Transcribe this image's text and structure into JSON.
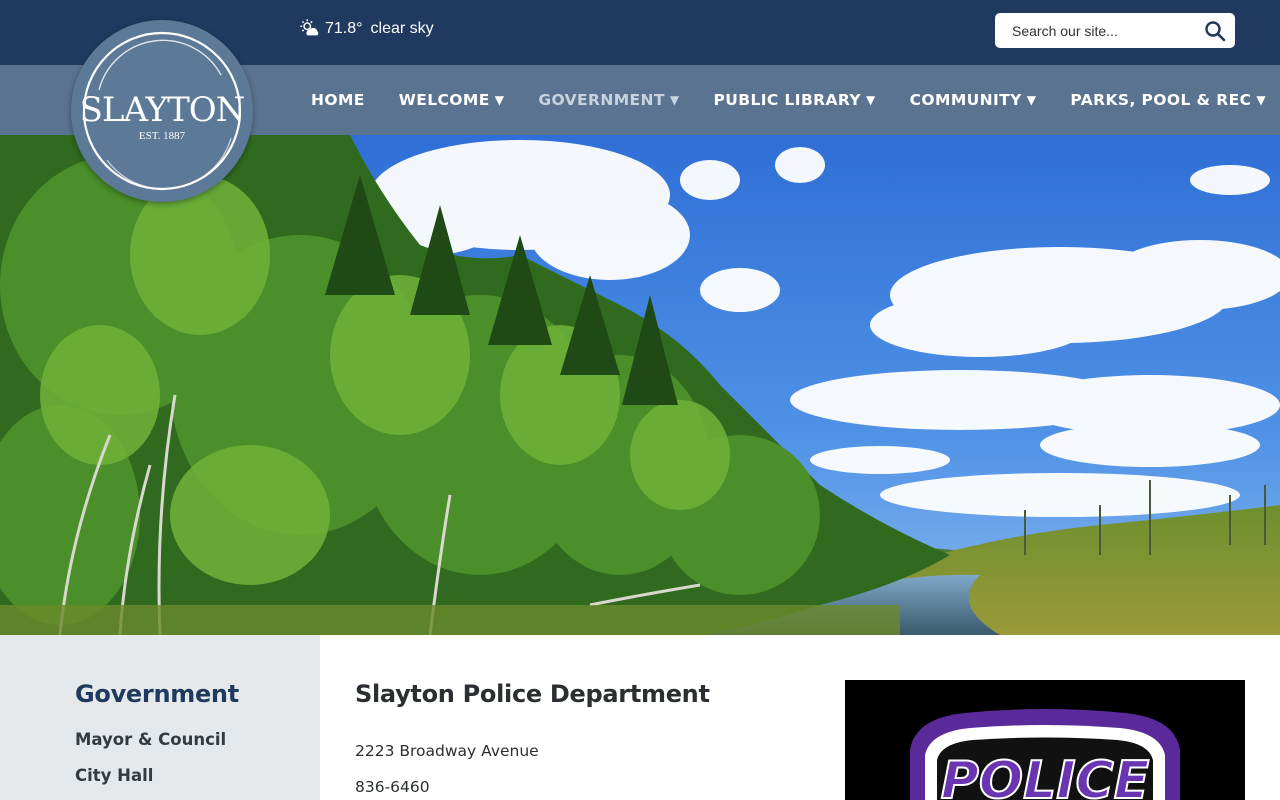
{
  "weather": {
    "icon": "sun-cloud-icon",
    "temperature": "71.8°",
    "description": "clear sky"
  },
  "search": {
    "placeholder": "Search our site...",
    "icon": "search-icon"
  },
  "logo": {
    "name": "SLAYTON",
    "established": "EST. 1887"
  },
  "nav": {
    "items": [
      {
        "label": "HOME",
        "caret": ""
      },
      {
        "label": "WELCOME",
        "caret": "▼"
      },
      {
        "label": "GOVERNMENT",
        "caret": "▼",
        "active": true
      },
      {
        "label": "PUBLIC LIBRARY",
        "caret": "▼"
      },
      {
        "label": "COMMUNITY",
        "caret": "▼"
      },
      {
        "label": "PARKS, POOL & REC",
        "caret": "▼"
      }
    ]
  },
  "sidebar": {
    "heading": "Government",
    "links": [
      "Mayor & Council",
      "City Hall"
    ]
  },
  "main": {
    "title": "Slayton Police Department",
    "address": "2223 Broadway Avenue",
    "phone": "836-6460"
  },
  "badge_image": {
    "text": "POLICE"
  },
  "colors": {
    "topbar": "#1f3a5e",
    "navbar": "#5a7390",
    "logo_circle": "#5c7a98",
    "sidebar_bg": "#e6e9ec",
    "heading": "#1f3a5e"
  }
}
